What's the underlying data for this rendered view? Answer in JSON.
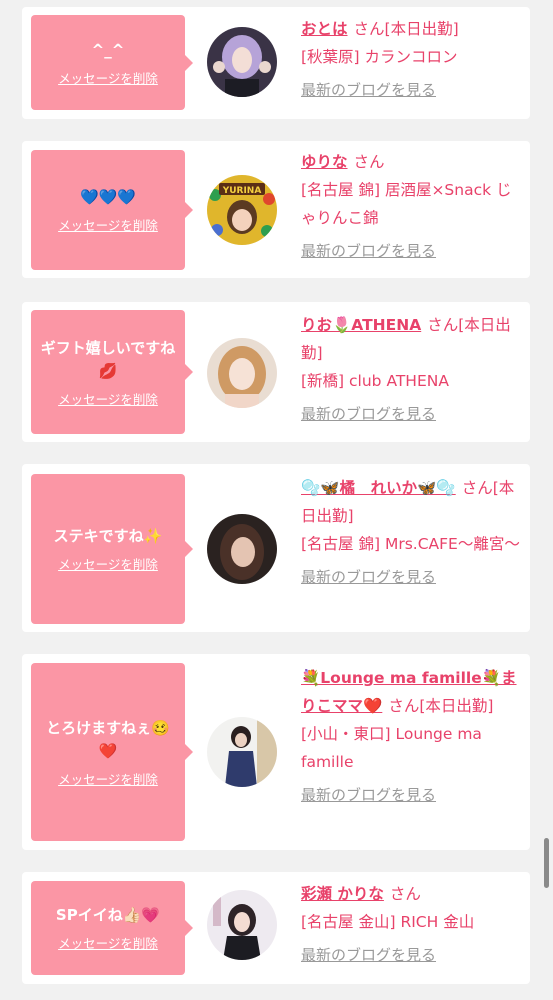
{
  "colors": {
    "accent": "#e8426a",
    "bubble": "#fb96a5",
    "link_gray": "#999999",
    "background": "#f1f1f1"
  },
  "delete_label": "メッセージを削除",
  "blog_label": "最新のブログを見る",
  "cards": [
    {
      "message": "^_^",
      "name": "おとは",
      "san_suffix": "さん[本日出勤]",
      "shop": "[秋葉原] カランコロン",
      "avatar_icon": "portrait-icon"
    },
    {
      "message": "💙💙💙",
      "name": "ゆりな",
      "san_suffix": "さん",
      "shop": "[名古屋 錦] 居酒屋×Snack じゃりんこ錦",
      "avatar_icon": "portrait-icon",
      "avatar_text": "YURINA"
    },
    {
      "message": "ギフト嬉しいですね💋",
      "name": "りお🌷ATHENA",
      "san_suffix": "さん[本日出勤]",
      "shop": "[新橋] club ATHENA",
      "avatar_icon": "portrait-icon"
    },
    {
      "message": "ステキですね✨",
      "name": "🫧🦋橘　れいか🦋🫧",
      "san_suffix": "さん[本日出勤]",
      "shop": "[名古屋 錦] Mrs.CAFE〜離宮〜",
      "avatar_icon": "portrait-icon"
    },
    {
      "message": "とろけますねぇ🥴❤️",
      "name": "💐Lounge ma famille💐まりこママ❤️",
      "san_suffix": "さん[本日出勤]",
      "shop": "[小山・東口] Lounge ma famille",
      "avatar_icon": "portrait-icon"
    },
    {
      "message": "SPイイね👍🏻💗",
      "name": "彩瀬 かりな",
      "san_suffix": "さん",
      "shop": "[名古屋 金山] RICH 金山",
      "avatar_icon": "portrait-icon"
    }
  ]
}
